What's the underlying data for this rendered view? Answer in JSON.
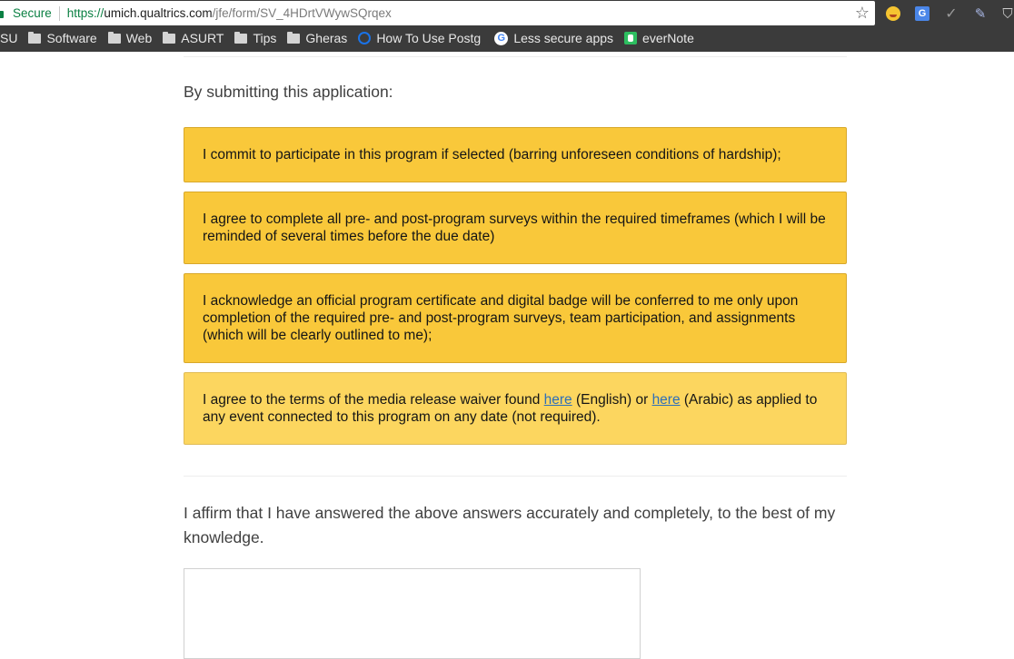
{
  "browser": {
    "secure_label": "Secure",
    "url_scheme": "https://",
    "url_host": "umich.qualtrics.com",
    "url_path": "/jfe/form/SV_4HDrtVWywSQrqex",
    "icons": [
      "lock-icon",
      "star-icon",
      "emoji-extension-icon",
      "translate-extension-icon",
      "extension-icon",
      "pen-extension-icon",
      "shield-extension-icon"
    ],
    "colors": {
      "secure": "#0b8043",
      "chrome_bg": "#3b3b3b"
    }
  },
  "bookmarks": [
    {
      "label": "SU",
      "icon": "none"
    },
    {
      "label": "Software",
      "icon": "folder-icon"
    },
    {
      "label": "Web",
      "icon": "folder-icon"
    },
    {
      "label": "ASURT",
      "icon": "folder-icon"
    },
    {
      "label": "Tips",
      "icon": "folder-icon"
    },
    {
      "label": "Gheras",
      "icon": "folder-icon"
    },
    {
      "label": "How To Use Postg",
      "icon": "postgres-favicon-icon"
    },
    {
      "label": "Less secure apps",
      "icon": "google-favicon-icon"
    },
    {
      "label": "everNote",
      "icon": "evernote-favicon-icon"
    }
  ],
  "form": {
    "intro": "By submitting this application:",
    "choices": [
      {
        "text": "I commit to participate in this program if selected (barring unforeseen conditions of hardship);"
      },
      {
        "text": "I agree to complete all pre- and post-program surveys within the required timeframes (which I will be reminded of several times before the due date)"
      },
      {
        "text": "I acknowledge an official program certificate and digital badge will be conferred to me only upon completion of the required pre- and post-program surveys, team participation, and assignments (which will be clearly outlined to me);"
      },
      {
        "text_before": "I agree to the terms of the media release waiver found ",
        "link1": "here",
        "text_middle": " (English) or ",
        "link2": "here",
        "text_after": " (Arabic) as applied to any event connected to this program on any date (not required)."
      }
    ],
    "affirm": "I affirm that I have answered the above answers accurately and completely, to the best of my knowledge.",
    "colors": {
      "choice_selected": "#f9c83a",
      "choice_light": "#fcd65f",
      "link": "#2e6fb8"
    }
  }
}
